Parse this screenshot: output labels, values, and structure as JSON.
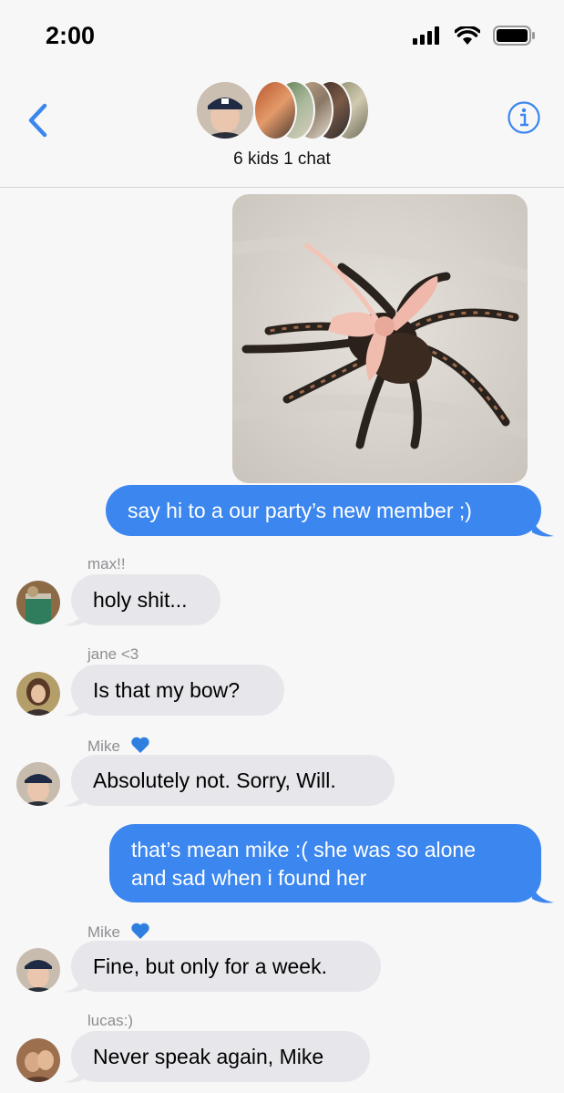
{
  "status": {
    "time": "2:00"
  },
  "header": {
    "title": "6 kids 1 chat"
  },
  "icons": {
    "back": "chevron-left-icon",
    "info": "info-icon",
    "signal": "cellular-signal-icon",
    "wifi": "wifi-icon",
    "battery": "battery-icon",
    "heart": "blue-heart-emoji"
  },
  "colors": {
    "accent": "#3b86ef",
    "incoming_bubble": "#e7e6eb",
    "sender_label": "#8e8e93"
  },
  "messages": [
    {
      "type": "outgoing-image",
      "description": ""
    },
    {
      "type": "outgoing",
      "text": "say hi to a our party’s new member ;)"
    },
    {
      "type": "incoming",
      "sender": "max!!",
      "text": "holy shit..."
    },
    {
      "type": "incoming",
      "sender": "jane <3",
      "text": "Is that my bow?"
    },
    {
      "type": "incoming",
      "sender": "Mike",
      "text": "Absolutely not. Sorry, Will."
    },
    {
      "type": "outgoing",
      "text_line1": "that’s mean mike :( she was so alone",
      "text_line2": "and sad when i found her"
    },
    {
      "type": "incoming",
      "sender": "Mike",
      "text": "Fine, but only for a week."
    },
    {
      "type": "incoming",
      "sender": "lucas:)",
      "text": "Never speak again, Mike"
    }
  ]
}
